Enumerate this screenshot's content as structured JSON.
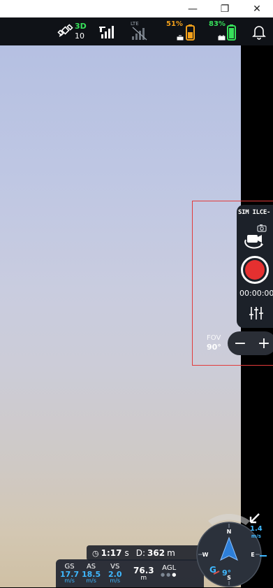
{
  "window": {
    "minimize": "—",
    "restore": "❐",
    "close": "✕"
  },
  "status": {
    "gps_fix": "3D",
    "satellites": "10",
    "link_label": "LTE",
    "drone_battery": "51%",
    "controller_battery": "83%",
    "colors": {
      "green": "#37e05a",
      "orange": "#f4a11b",
      "blue": "#3fb8ff"
    }
  },
  "camera": {
    "label": "SIM ILCE-",
    "record_time": "00:00:00",
    "fov_label": "FOV",
    "fov_value": "90°",
    "zoom_out": "−",
    "zoom_in": "+"
  },
  "flight": {
    "time_value": "1:17",
    "time_unit": "s",
    "distance_label": "D:",
    "distance_value": "362",
    "distance_unit": "m",
    "telemetry": [
      {
        "label": "GS",
        "value": "17.7",
        "unit": "m/s"
      },
      {
        "label": "AS",
        "value": "18.5",
        "unit": "m/s"
      },
      {
        "label": "VS",
        "value": "2.0",
        "unit": "m/s"
      }
    ],
    "altitude_value": "76.3",
    "altitude_unit": "m",
    "altitude_ref": "AGL",
    "heading": "9°",
    "wind_speed": "1.4",
    "wind_unit": "m/s"
  }
}
